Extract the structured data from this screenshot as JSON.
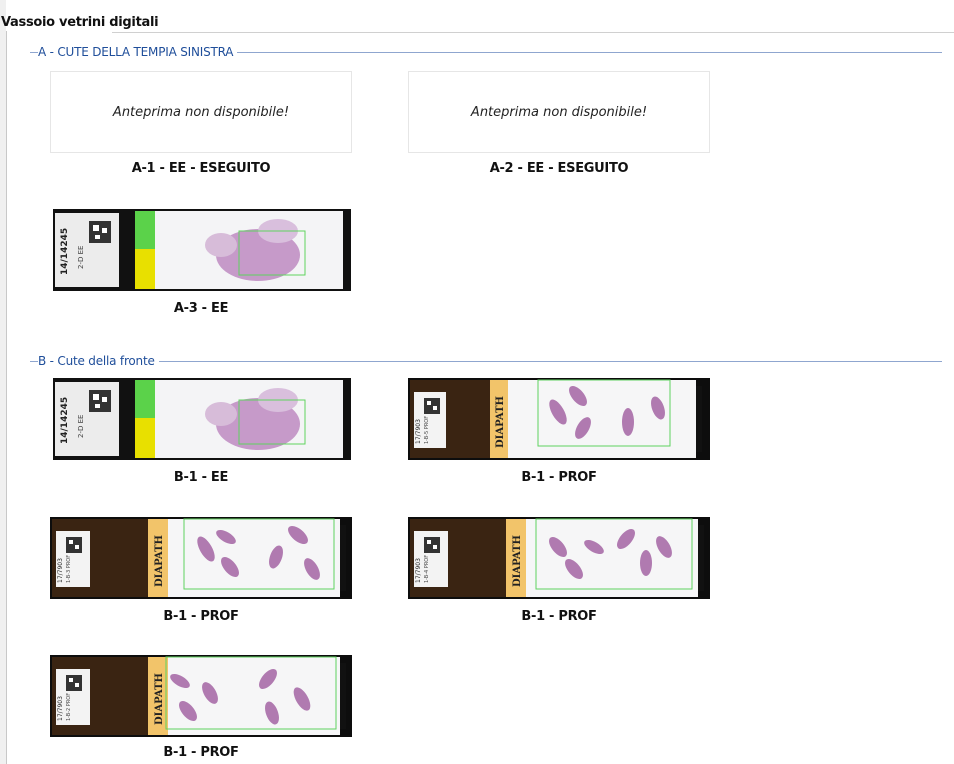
{
  "window": {
    "title": "Vassoio vetrini digitali"
  },
  "groups": [
    {
      "legend": "A - CUTE DELLA TEMPIA SINISTRA",
      "slides": [
        {
          "caption": "A-1 - EE - ESEGUITO",
          "preview": "Anteprima non disponibile!"
        },
        {
          "caption": "A-2 - EE - ESEGUITO",
          "preview": "Anteprima non disponibile!"
        },
        {
          "caption": "A-3 - EE",
          "label_text": "14/14245",
          "label_sub": "2-D EE"
        }
      ]
    },
    {
      "legend": "B - Cute della fronte",
      "slides": [
        {
          "caption": "B-1 - EE",
          "label_text": "14/14245",
          "label_sub": "2-D EE"
        },
        {
          "caption": "B-1 - PROF",
          "brand": "DIAPATH",
          "label_text": "17/7903",
          "label_sub": "1-B-5 PROF"
        },
        {
          "caption": "B-1 - PROF",
          "brand": "DIAPATH",
          "label_text": "17/7903",
          "label_sub": "1-B-3 PROF"
        },
        {
          "caption": "B-1 - PROF",
          "brand": "DIAPATH",
          "label_text": "17/7903",
          "label_sub": "1-B-4 PROF"
        },
        {
          "caption": "B-1 - PROF",
          "brand": "DIAPATH",
          "label_text": "17/7903",
          "label_sub": "1-B-2 PROF"
        }
      ]
    }
  ],
  "colors": {
    "legend": "#1f4e9a",
    "group_line": "#8fa6cf",
    "scan_region": "#5fd35f",
    "tissue": "#b07ab0",
    "diapath_label": "#f2c46a"
  }
}
